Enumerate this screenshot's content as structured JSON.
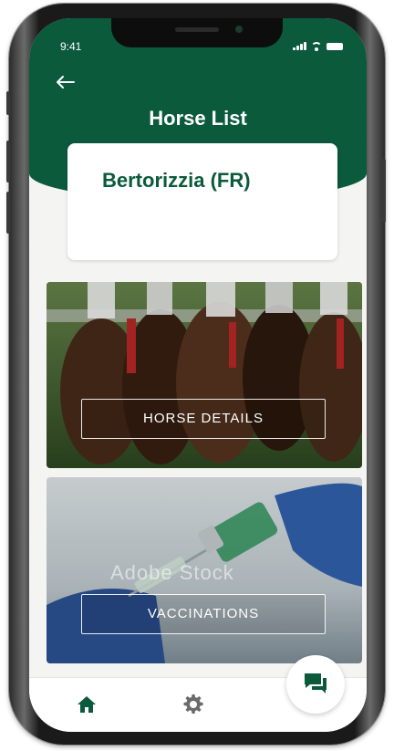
{
  "status_bar": {
    "time": "9:41"
  },
  "header": {
    "title": "Horse List",
    "back_icon": "arrow-left-icon"
  },
  "horse_card": {
    "name": "Bertorizzia (FR)"
  },
  "tiles": [
    {
      "label": "HORSE DETAILS",
      "image": "racing-horses-photo"
    },
    {
      "label": "VACCINATIONS",
      "image": "vaccine-syringe-photo",
      "watermark": "Adobe Stock"
    }
  ],
  "bottom_nav": {
    "items": [
      "home-icon",
      "gear-icon"
    ],
    "fab": "chat-icon"
  },
  "colors": {
    "brand_green": "#0b5a3c",
    "background": "#f4f4f2"
  }
}
